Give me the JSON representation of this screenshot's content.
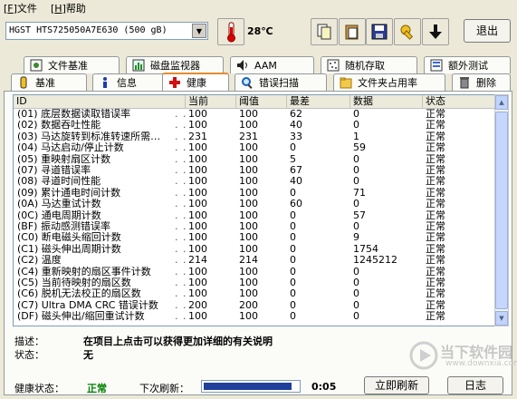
{
  "menu": {
    "file": "文件",
    "file_key": "F",
    "help": "帮助",
    "help_key": "H"
  },
  "toolbar": {
    "drive": "HGST HTS725050A7E630  (500 gB)",
    "temperature": "28℃",
    "exit": "退出"
  },
  "tabs_top": [
    "文件基准",
    "磁盘监视器",
    "AAM",
    "随机存取",
    "额外测试"
  ],
  "tabs_bottom": [
    "基准",
    "信息",
    "健康",
    "错误扫描",
    "文件夹占用率",
    "删除"
  ],
  "active_tab": "健康",
  "table": {
    "headers": [
      "ID",
      "当前",
      "阈值",
      "最差",
      "数据",
      "状态"
    ],
    "rows": [
      [
        "(01) 底层数据读取错误率",
        "100",
        "100",
        "62",
        "0",
        "正常"
      ],
      [
        "(02) 数据吞吐性能",
        "100",
        "100",
        "40",
        "0",
        "正常"
      ],
      [
        "(03) 马达旋转到标准转速所需…",
        "231",
        "231",
        "33",
        "1",
        "正常"
      ],
      [
        "(04) 马达启动/停止计数",
        "100",
        "100",
        "0",
        "59",
        "正常"
      ],
      [
        "(05) 重映射扇区计数",
        "100",
        "100",
        "5",
        "0",
        "正常"
      ],
      [
        "(07) 寻道错误率",
        "100",
        "100",
        "67",
        "0",
        "正常"
      ],
      [
        "(08) 寻道时间性能",
        "100",
        "100",
        "40",
        "0",
        "正常"
      ],
      [
        "(09) 累计通电时间计数",
        "100",
        "100",
        "0",
        "71",
        "正常"
      ],
      [
        "(0A) 马达重试计数",
        "100",
        "100",
        "60",
        "0",
        "正常"
      ],
      [
        "(0C) 通电周期计数",
        "100",
        "100",
        "0",
        "57",
        "正常"
      ],
      [
        "(BF) 振动感测错误率",
        "100",
        "100",
        "0",
        "0",
        "正常"
      ],
      [
        "(C0) 断电磁头缩回计数",
        "100",
        "100",
        "0",
        "9",
        "正常"
      ],
      [
        "(C1) 磁头伸出周期计数",
        "100",
        "100",
        "0",
        "1754",
        "正常"
      ],
      [
        "(C2) 温度",
        "214",
        "214",
        "0",
        "1245212",
        "正常"
      ],
      [
        "(C4) 重新映射的扇区事件计数",
        "100",
        "100",
        "0",
        "0",
        "正常"
      ],
      [
        "(C5) 当前待映射的扇区数",
        "100",
        "100",
        "0",
        "0",
        "正常"
      ],
      [
        "(C6) 脱机无法校正的扇区数",
        "100",
        "100",
        "0",
        "0",
        "正常"
      ],
      [
        "(C7) Ultra DMA CRC 错误计数",
        "200",
        "200",
        "0",
        "0",
        "正常"
      ],
      [
        "(DF) 磁头伸出/缩回重试计数",
        "100",
        "100",
        "0",
        "0",
        "正常"
      ]
    ]
  },
  "details": {
    "desc_label": "描述：",
    "desc_value": "在项目上点击可以获得更加详细的有关说明",
    "status_label": "状态：",
    "status_value": "无"
  },
  "status_bar": {
    "health_label": "健康状态：",
    "health_value": "正常",
    "refresh_label": "下次刷新：",
    "progress_fraction": 0.93,
    "timer": "0:05",
    "refresh_now": "立即刷新",
    "log": "日志"
  },
  "watermark": {
    "text": "当下软件园",
    "url": "www.downxia.com"
  }
}
